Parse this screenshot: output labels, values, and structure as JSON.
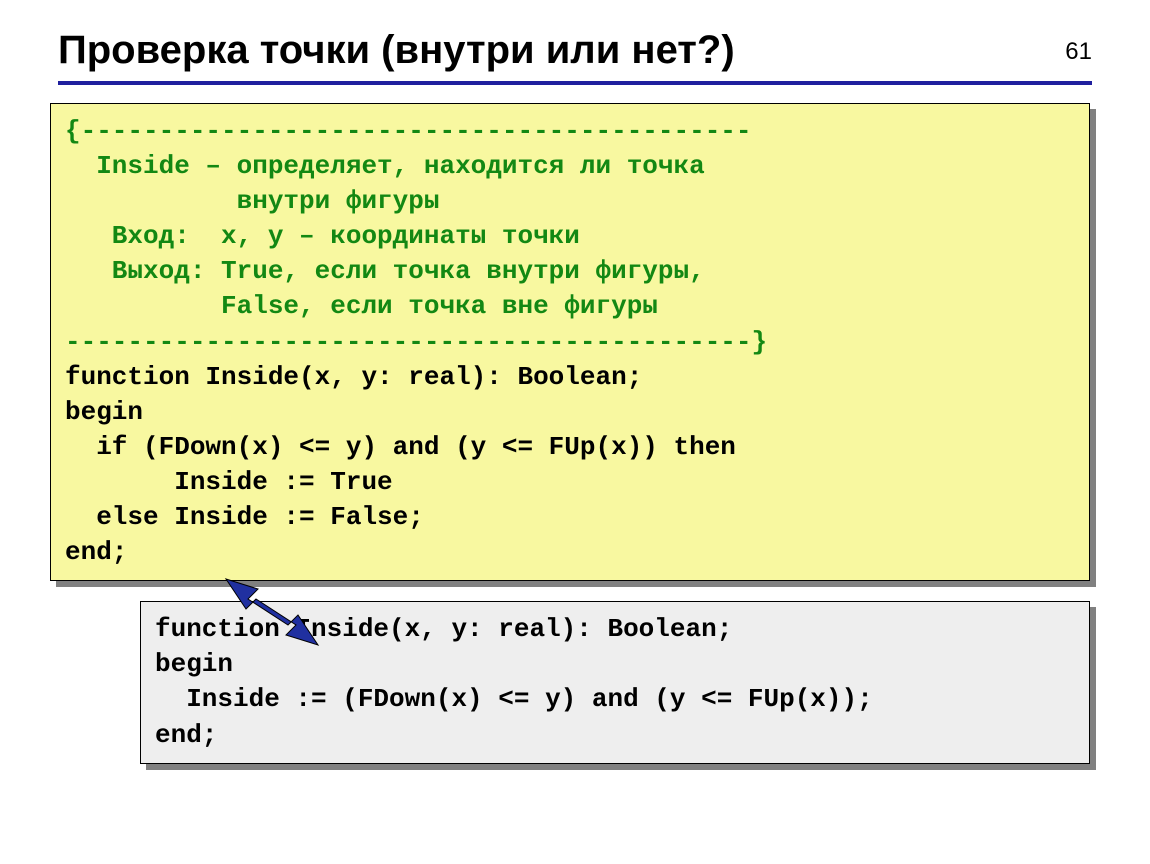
{
  "page_number": "61",
  "title": "Проверка точки (внутри или нет?)",
  "box1": {
    "comment_lines": [
      "{-------------------------------------------",
      "  Inside – определяет, находится ли точка",
      "           внутри фигуры",
      "   Вход:  x, y – координаты точки",
      "   Выход: True, если точка внутри фигуры,",
      "          False, если точка вне фигуры",
      "--------------------------------------------}"
    ],
    "code_lines": [
      "function Inside(x, y: real): Boolean;",
      "begin",
      "  if (FDown(x) <= y) and (y <= FUp(x)) then",
      "       Inside := True",
      "  else Inside := False;",
      "end;"
    ]
  },
  "box2": {
    "code_lines": [
      "function Inside(x, y: real): Boolean;",
      "begin",
      "  Inside := (FDown(x) <= y) and (y <= FUp(x));",
      "end;"
    ]
  },
  "colors": {
    "accent_rule": "#1f1f9e",
    "box1_bg": "#f8f8a0",
    "box2_bg": "#eeeeee",
    "comment": "#138813",
    "arrow": "#2030a0"
  }
}
